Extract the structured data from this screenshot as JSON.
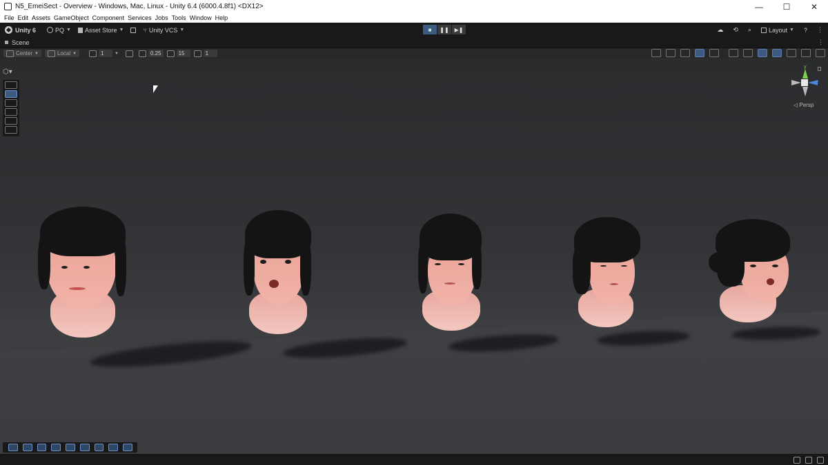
{
  "window": {
    "title": "N5_EmeiSect - Overview - Windows, Mac, Linux - Unity 6.4 (6000.4.8f1) <DX12>",
    "controls": [
      "—",
      "☐",
      "✕"
    ]
  },
  "menu": [
    "File",
    "Edit",
    "Assets",
    "GameObject",
    "Component",
    "Services",
    "Jobs",
    "Tools",
    "Window",
    "Help"
  ],
  "toolbar": {
    "unity_label": "Unity 6",
    "account_label": "PQ",
    "asset_store_label": "Asset Store",
    "vcs_label": "Unity VCS",
    "layout_label": "Layout",
    "play_icons": [
      "■",
      "❚❚",
      "▶❚"
    ]
  },
  "scene_tab": {
    "label": "Scene"
  },
  "scene_toolbar": {
    "pivot_mode": "Center",
    "pivot_rotation": "Local",
    "grid_size": "1",
    "snap_move": "0.25",
    "snap_rotate": "15",
    "snap_scale": "1"
  },
  "viewport": {
    "projection_label": "◁ Persp",
    "axis_y": "y",
    "axis_z": "z"
  }
}
